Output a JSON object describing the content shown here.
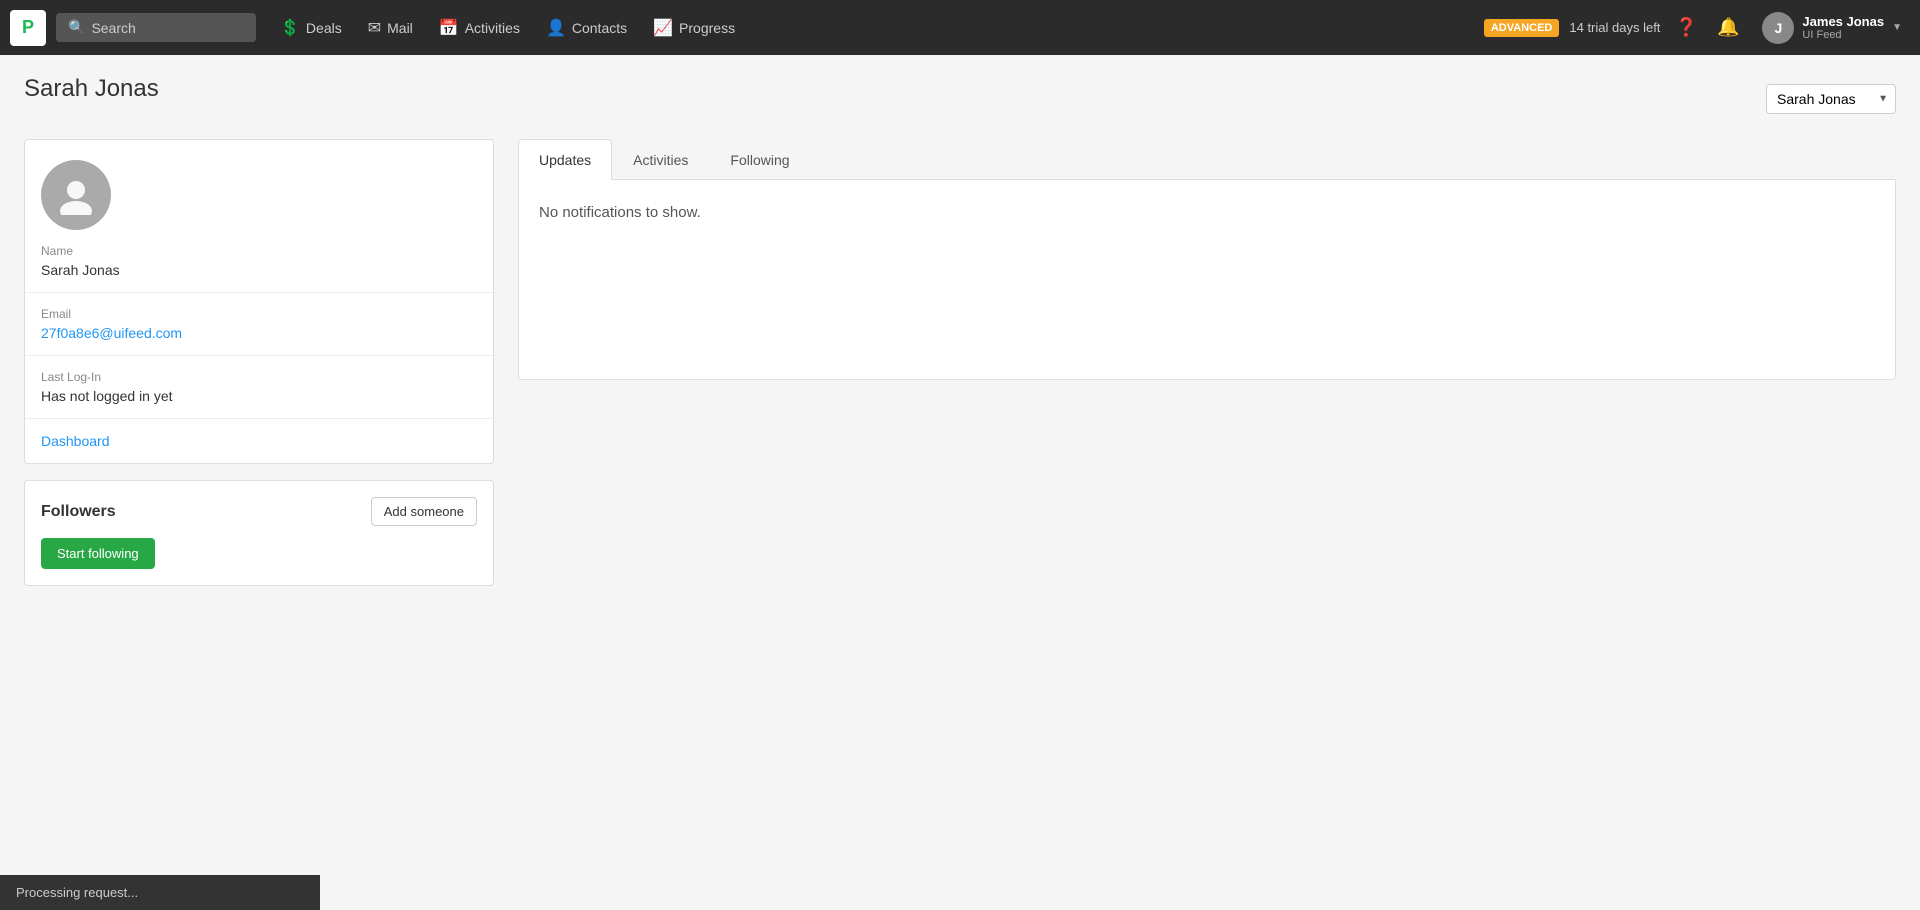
{
  "topnav": {
    "logo_text": "P",
    "search_placeholder": "Search",
    "nav_items": [
      {
        "id": "deals",
        "label": "Deals",
        "icon": "💲"
      },
      {
        "id": "mail",
        "label": "Mail",
        "icon": "✉"
      },
      {
        "id": "activities",
        "label": "Activities",
        "icon": "📅"
      },
      {
        "id": "contacts",
        "label": "Contacts",
        "icon": "👤"
      },
      {
        "id": "progress",
        "label": "Progress",
        "icon": "📈"
      }
    ],
    "advanced_badge": "ADVANCED",
    "trial_text": "14 trial days left",
    "user_name": "James Jonas",
    "user_sub": "UI Feed"
  },
  "page": {
    "title": "Sarah Jonas",
    "top_select_value": "Sarah Jonas"
  },
  "left_panel": {
    "name_label": "Name",
    "name_value": "Sarah Jonas",
    "email_label": "Email",
    "email_value": "27f0a8e6@uifeed.com",
    "last_login_label": "Last log-in",
    "last_login_value": "Has not logged in yet",
    "dashboard_label": "Dashboard",
    "followers_title": "Followers",
    "add_someone_label": "Add someone",
    "start_following_label": "Start following"
  },
  "tabs": [
    {
      "id": "updates",
      "label": "Updates",
      "active": true
    },
    {
      "id": "activities",
      "label": "Activities",
      "active": false
    },
    {
      "id": "following",
      "label": "Following",
      "active": false
    }
  ],
  "tab_content": {
    "no_notifications": "No notifications to show."
  },
  "processing_bar": {
    "text": "Processing request..."
  }
}
